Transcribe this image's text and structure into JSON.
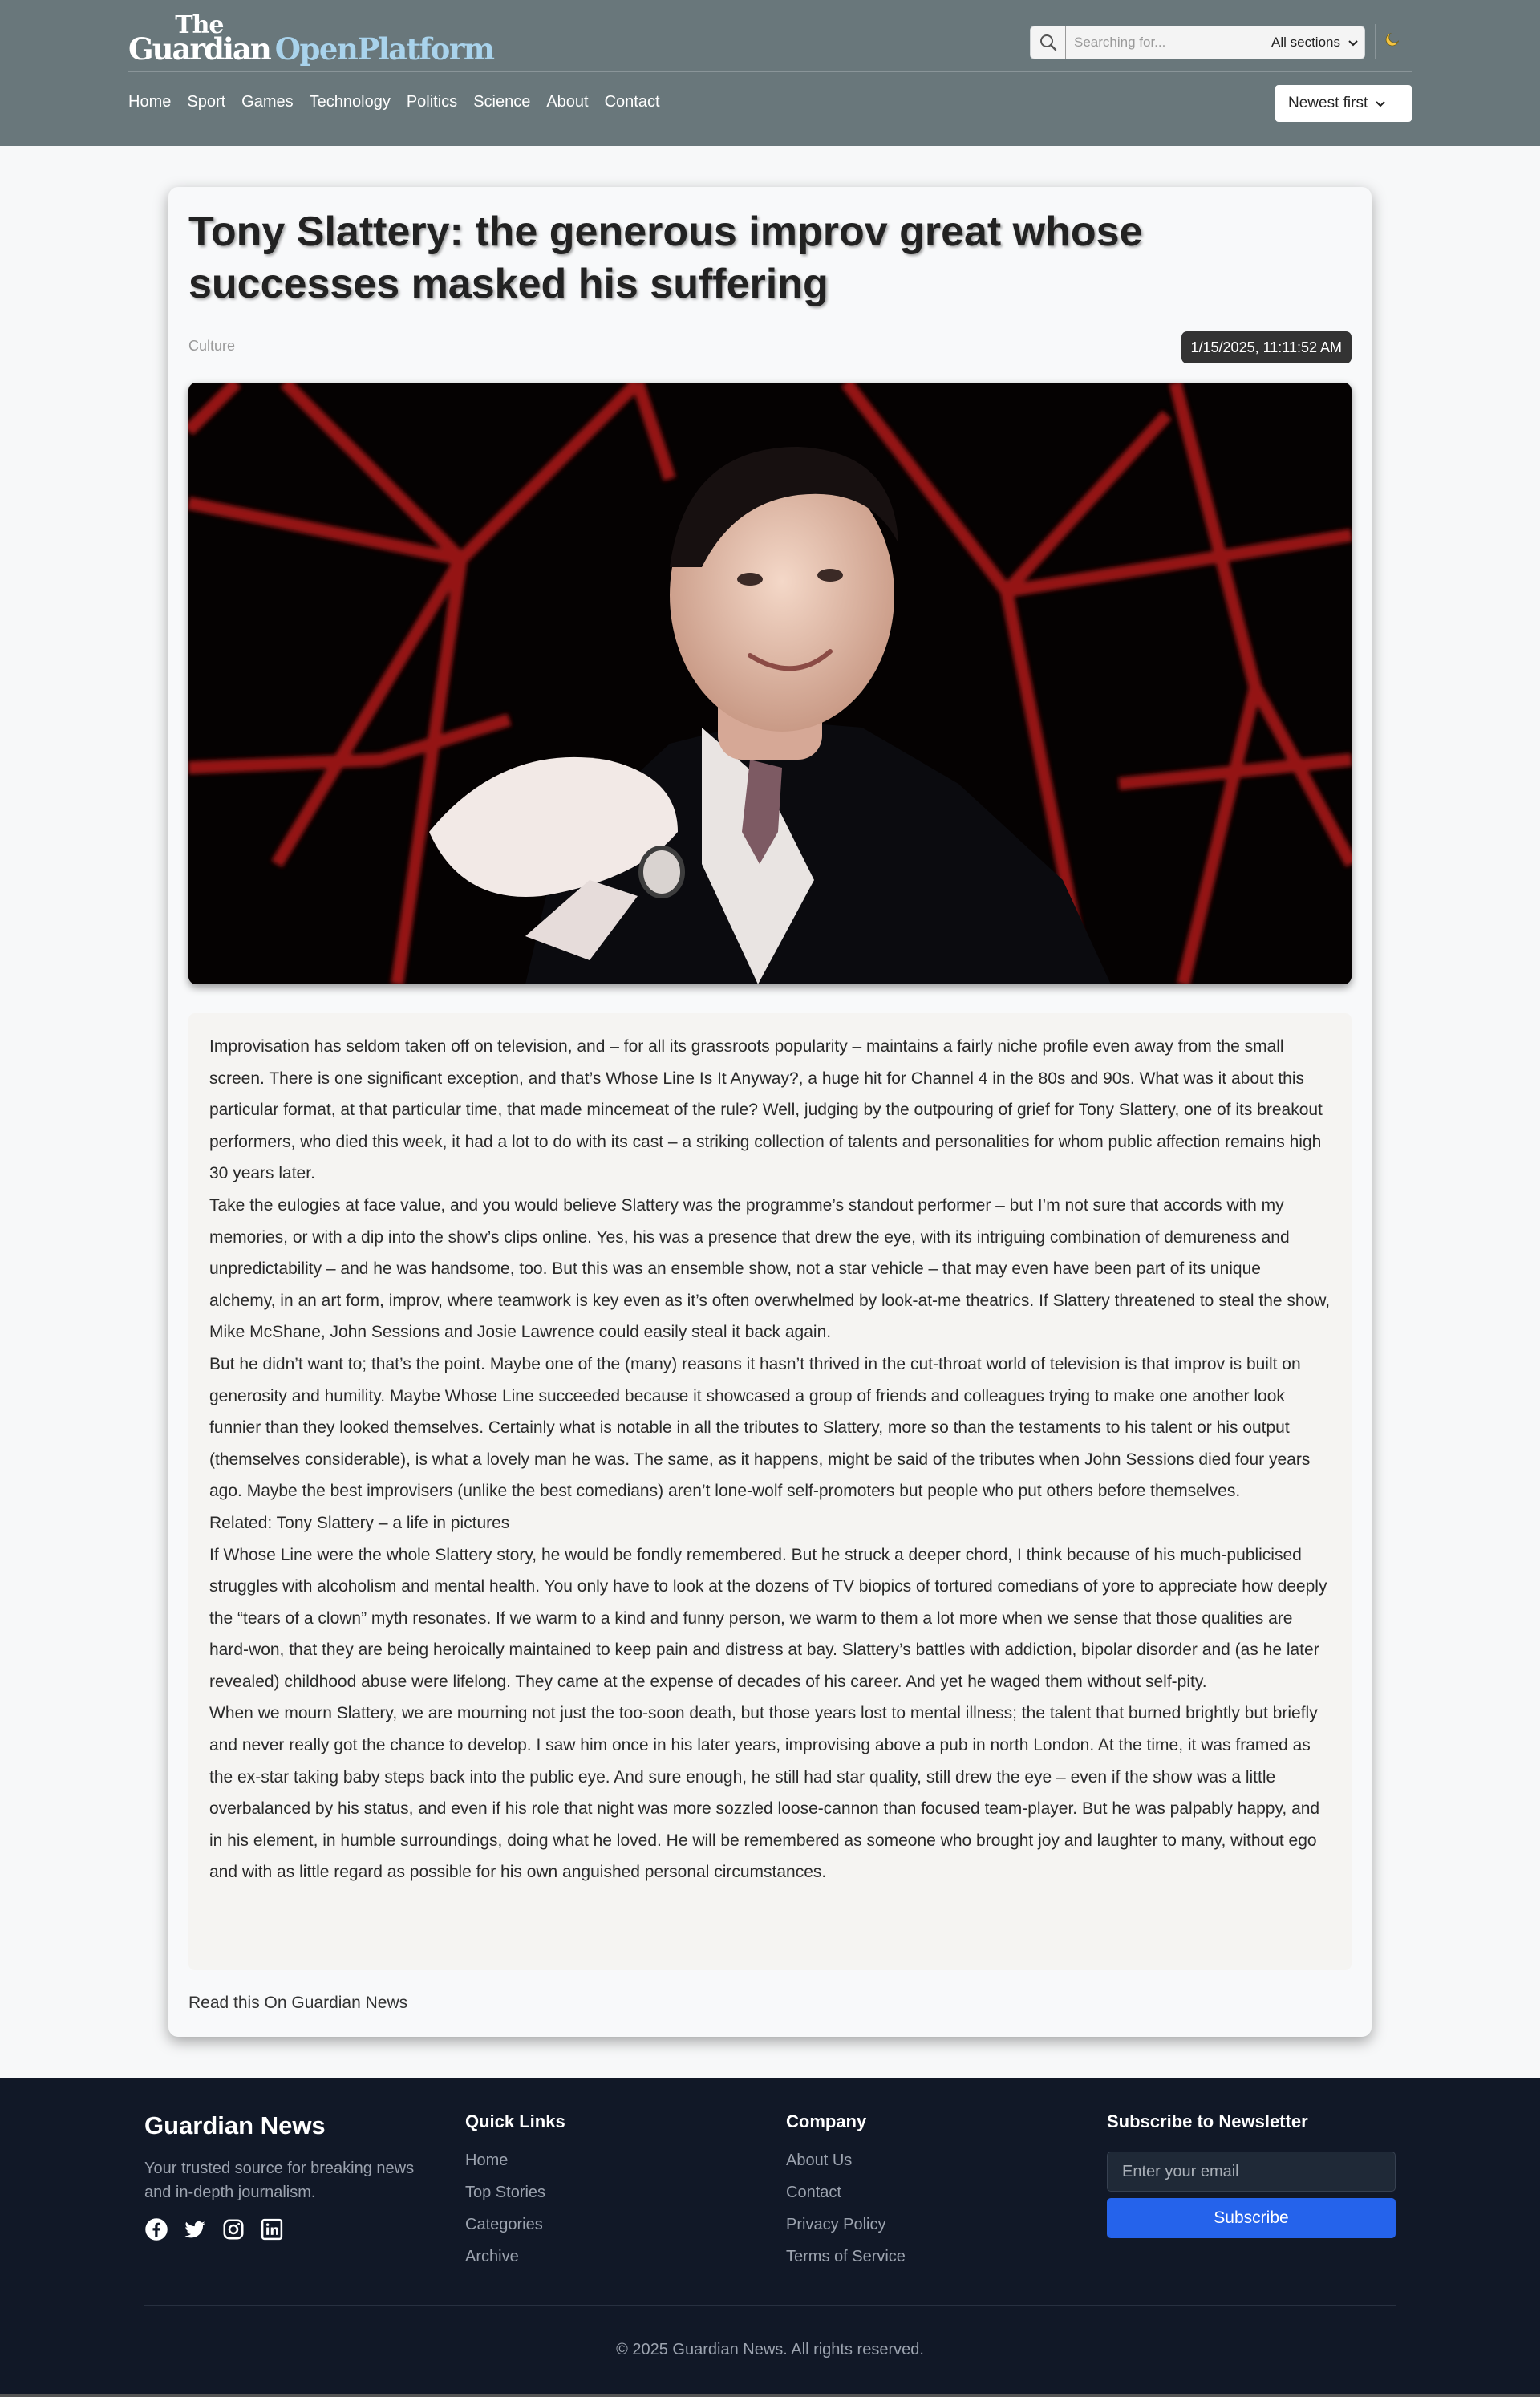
{
  "header": {
    "logo_the": "The",
    "logo_guardian": "Guardian",
    "logo_open_platform": "OpenPlatform",
    "search_placeholder": "Searching for...",
    "section_filter": "All sections",
    "theme_toggle_icon": "moon-icon",
    "sort_select": "Newest first"
  },
  "nav": {
    "items": [
      "Home",
      "Sport",
      "Games",
      "Technology",
      "Politics",
      "Science",
      "About",
      "Contact"
    ]
  },
  "article": {
    "title": "Tony Slattery: the generous improv great whose successes masked his suffering",
    "category": "Culture",
    "date": "1/15/2025, 11:11:52 AM",
    "paragraphs": [
      "Improvisation has seldom taken off on television, and – for all its grassroots popularity – maintains a fairly niche profile even away from the small screen. There is one significant exception, and that’s Whose Line Is It Anyway?, a huge hit for Channel 4 in the 80s and 90s. What was it about this particular format, at that particular time, that made mincemeat of the rule? Well, judging by the outpouring of grief for Tony Slattery, one of its breakout performers, who died this week, it had a lot to do with its cast – a striking collection of talents and personalities for whom public affection remains high 30 years later.",
      "Take the eulogies at face value, and you would believe Slattery was the programme’s standout performer – but I’m not sure that accords with my memories, or with a dip into the show’s clips online. Yes, his was a presence that drew the eye, with its intriguing combination of demureness and unpredictability – and he was handsome, too. But this was an ensemble show, not a star vehicle – that may even have been part of its unique alchemy, in an art form, improv, where teamwork is key even as it’s often overwhelmed by look-at-me theatrics. If Slattery threatened to steal the show, Mike McShane, John Sessions and Josie Lawrence could easily steal it back again.",
      "But he didn’t want to; that’s the point. Maybe one of the (many) reasons it hasn’t thrived in the cut-throat world of television is that improv is built on generosity and humility. Maybe Whose Line succeeded because it showcased a group of friends and colleagues trying to make one another look funnier than they looked themselves. Certainly what is notable in all the tributes to Slattery, more so than the testaments to his talent or his output (themselves considerable), is what a lovely man he was. The same, as it happens, might be said of the tributes when John Sessions died four years ago. Maybe the best improvisers (unlike the best comedians) aren’t lone-wolf self-promoters but people who put others before themselves.",
      "Related: Tony Slattery – a life in pictures",
      "If Whose Line were the whole Slattery story, he would be fondly remembered. But he struck a deeper chord, I think because of his much-publicised struggles with alcoholism and mental health. You only have to look at the dozens of TV biopics of tortured comedians of yore to appreciate how deeply the “tears of a clown” myth resonates. If we warm to a kind and funny person, we warm to them a lot more when we sense that those qualities are hard-won, that they are being heroically maintained to keep pain and distress at bay. Slattery’s battles with addiction, bipolar disorder and (as he later revealed) childhood abuse were lifelong. They came at the expense of decades of his career. And yet he waged them without self-pity.",
      "When we mourn Slattery, we are mourning not just the too-soon death, but those years lost to mental illness; the talent that burned brightly but briefly and never really got the chance to develop. I saw him once in his later years, improvising above a pub in north London. At the time, it was framed as the ex-star taking baby steps back into the public eye. And sure enough, he still had star quality, still drew the eye – even if the show was a little overbalanced by his status, and even if his role that night was more sozzled loose-cannon than focused team-player. But he was palpably happy, and in his element, in humble surroundings, doing what he loved. He will be remembered as someone who brought joy and laughter to many, without ego and with as little regard as possible for his own anguished personal circumstances."
    ],
    "read_link": "Read this On Guardian News"
  },
  "footer": {
    "brand": "Guardian News",
    "tagline": "Your trusted source for breaking news and in-depth journalism.",
    "social_icons": [
      "facebook-icon",
      "twitter-icon",
      "instagram-icon",
      "linkedin-icon"
    ],
    "quick_links": {
      "heading": "Quick Links",
      "items": [
        "Home",
        "Top Stories",
        "Categories",
        "Archive"
      ]
    },
    "company": {
      "heading": "Company",
      "items": [
        "About Us",
        "Contact",
        "Privacy Policy",
        "Terms of Service"
      ]
    },
    "newsletter": {
      "heading": "Subscribe to Newsletter",
      "email_placeholder": "Enter your email",
      "button": "Subscribe"
    },
    "copyright": "© 2025 Guardian News. All rights reserved."
  }
}
